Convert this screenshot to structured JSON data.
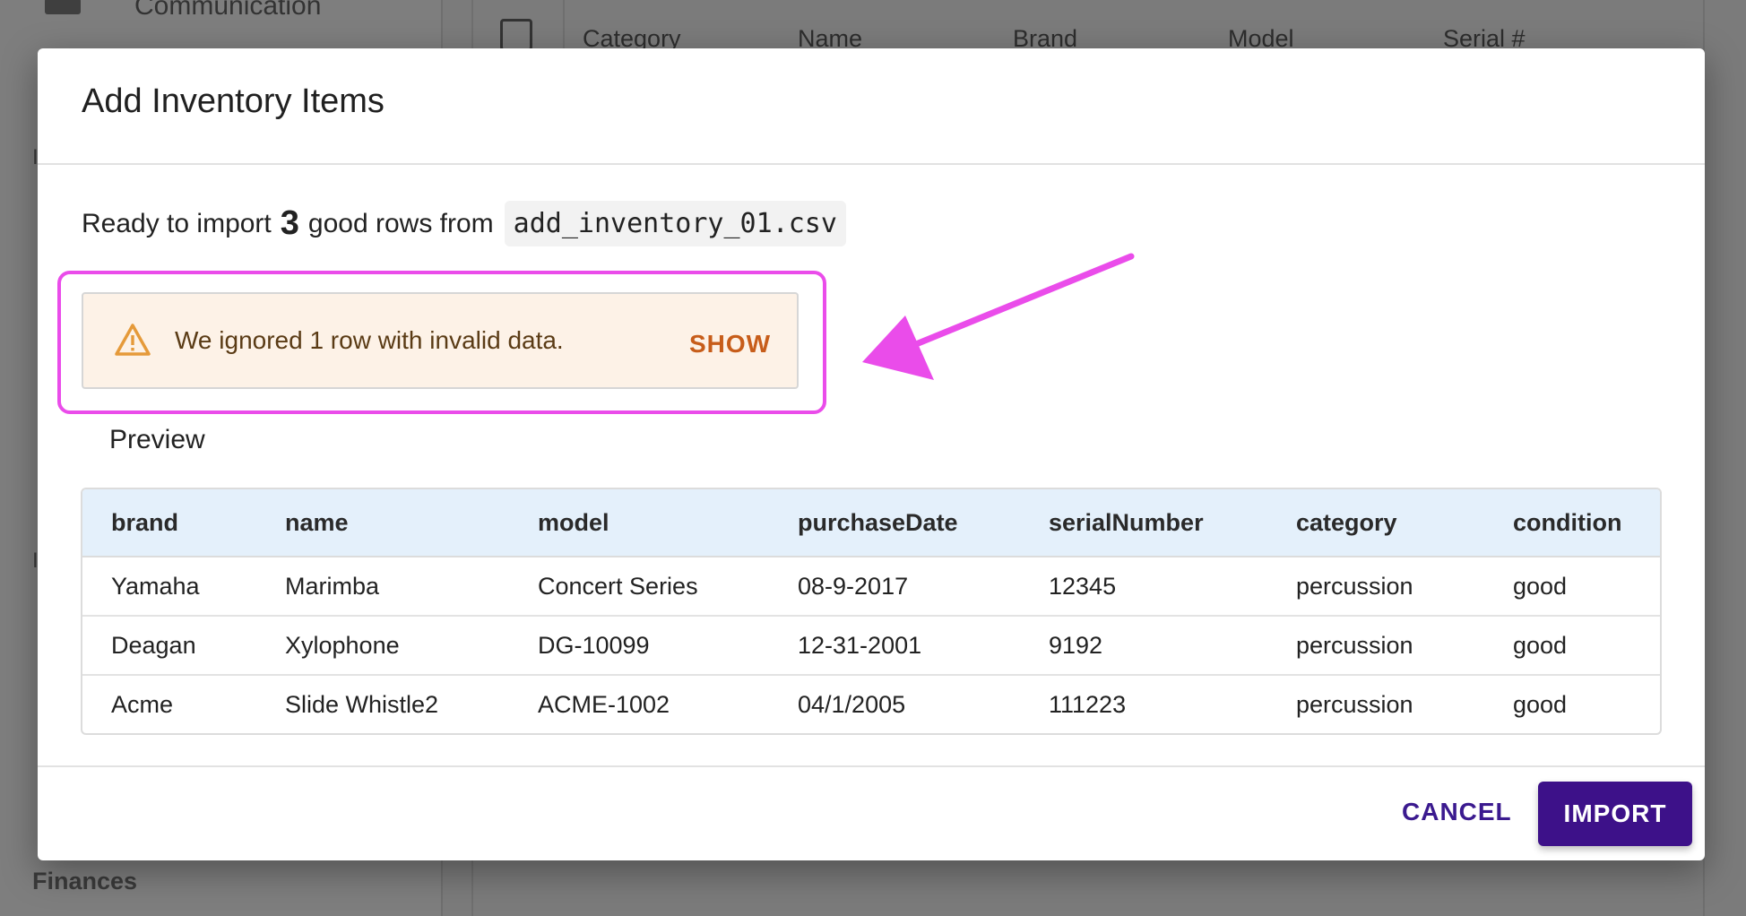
{
  "background": {
    "sidebar": {
      "top_item": "Communication",
      "bottom_item": "Finances"
    },
    "table_headers": [
      "Category",
      "Name",
      "Brand",
      "Model",
      "Serial #"
    ]
  },
  "dialog": {
    "title": "Add Inventory Items",
    "ready_prefix": "Ready to import",
    "ready_count": "3",
    "ready_suffix": "good rows from",
    "filename": "add_inventory_01.csv",
    "warning": {
      "icon": "warning-triangle-icon",
      "text": "We ignored 1 row with invalid data.",
      "action": "SHOW"
    },
    "preview_label": "Preview",
    "table": {
      "headers": [
        "brand",
        "name",
        "model",
        "purchaseDate",
        "serialNumber",
        "category",
        "condition"
      ],
      "rows": [
        [
          "Yamaha",
          "Marimba",
          "Concert Series",
          "08-9-2017",
          "12345",
          "percussion",
          "good"
        ],
        [
          "Deagan",
          "Xylophone",
          "DG-10099",
          "12-31-2001",
          "9192",
          "percussion",
          "good"
        ],
        [
          "Acme",
          "Slide Whistle2",
          "ACME-1002",
          "04/1/2005",
          "111223",
          "percussion",
          "good"
        ]
      ]
    },
    "cancel_label": "CANCEL",
    "import_label": "IMPORT"
  },
  "colors": {
    "annotation": "#ea4cea",
    "primary": "#3d1189",
    "warning_bg": "#fdf2e7",
    "warning_action": "#c75d1a",
    "table_header_bg": "#e4f0fb"
  }
}
